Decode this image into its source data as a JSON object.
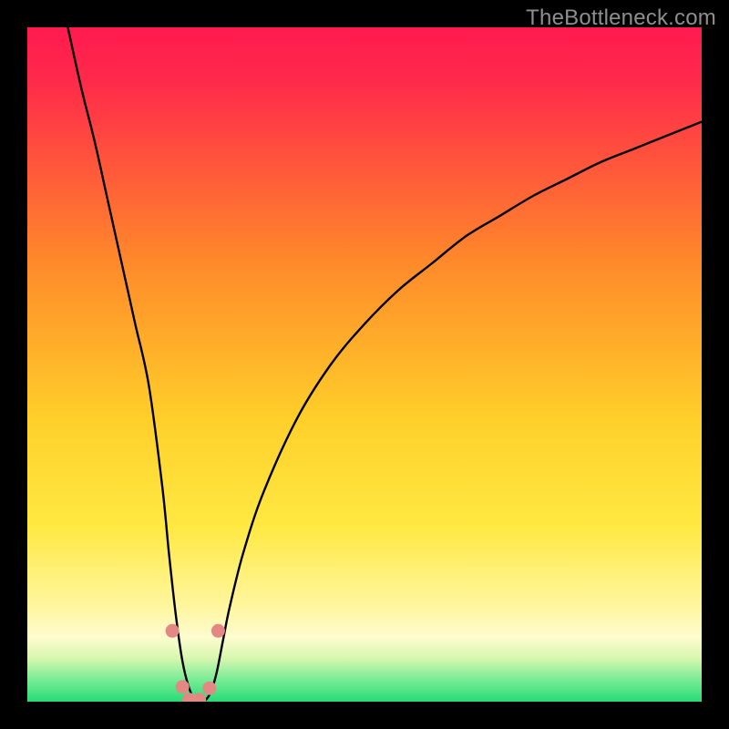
{
  "watermark": "TheBottleneck.com",
  "colors": {
    "frame": "#000000",
    "curve": "#000000",
    "marker_fill": "#e48884",
    "marker_stroke": "#d46b66",
    "grad_top": "#ff1a50",
    "grad_mid1": "#ff8a2a",
    "grad_mid2": "#ffe030",
    "grad_low": "#fff8a8",
    "grad_base": "#2de07a"
  },
  "chart_data": {
    "type": "line",
    "title": "",
    "xlabel": "",
    "ylabel": "",
    "xlim": [
      0,
      100
    ],
    "ylim": [
      0,
      100
    ],
    "series": [
      {
        "name": "bottleneck-curve",
        "x": [
          6,
          8,
          10,
          12,
          14,
          16,
          18,
          20,
          21,
          22,
          23,
          24,
          25,
          26,
          27,
          28,
          29,
          30,
          32,
          35,
          40,
          45,
          50,
          55,
          60,
          65,
          70,
          75,
          80,
          85,
          90,
          95,
          100
        ],
        "y": [
          100,
          91,
          83,
          74,
          65,
          56,
          47,
          32,
          22,
          13,
          6,
          2,
          0,
          0,
          1,
          4,
          9,
          14,
          22,
          31,
          42,
          50,
          56,
          61,
          65,
          69,
          72,
          75,
          77.5,
          80,
          82,
          84,
          86
        ]
      }
    ],
    "markers": {
      "name": "highlight-dots",
      "x": [
        21.5,
        23.0,
        24.0,
        25.5,
        27.0,
        28.3
      ],
      "y": [
        10.5,
        2.2,
        0.3,
        0.3,
        2.0,
        10.5
      ]
    },
    "gradient_stops": [
      {
        "pos": 0.0,
        "color": "#ff1a50"
      },
      {
        "pos": 0.08,
        "color": "#ff2a4a"
      },
      {
        "pos": 0.35,
        "color": "#ff8a2a"
      },
      {
        "pos": 0.58,
        "color": "#ffcf2a"
      },
      {
        "pos": 0.74,
        "color": "#ffe942"
      },
      {
        "pos": 0.86,
        "color": "#fff6a0"
      },
      {
        "pos": 0.905,
        "color": "#fdfccf"
      },
      {
        "pos": 0.935,
        "color": "#d9f7b0"
      },
      {
        "pos": 0.965,
        "color": "#7fed98"
      },
      {
        "pos": 1.0,
        "color": "#27db76"
      }
    ]
  }
}
